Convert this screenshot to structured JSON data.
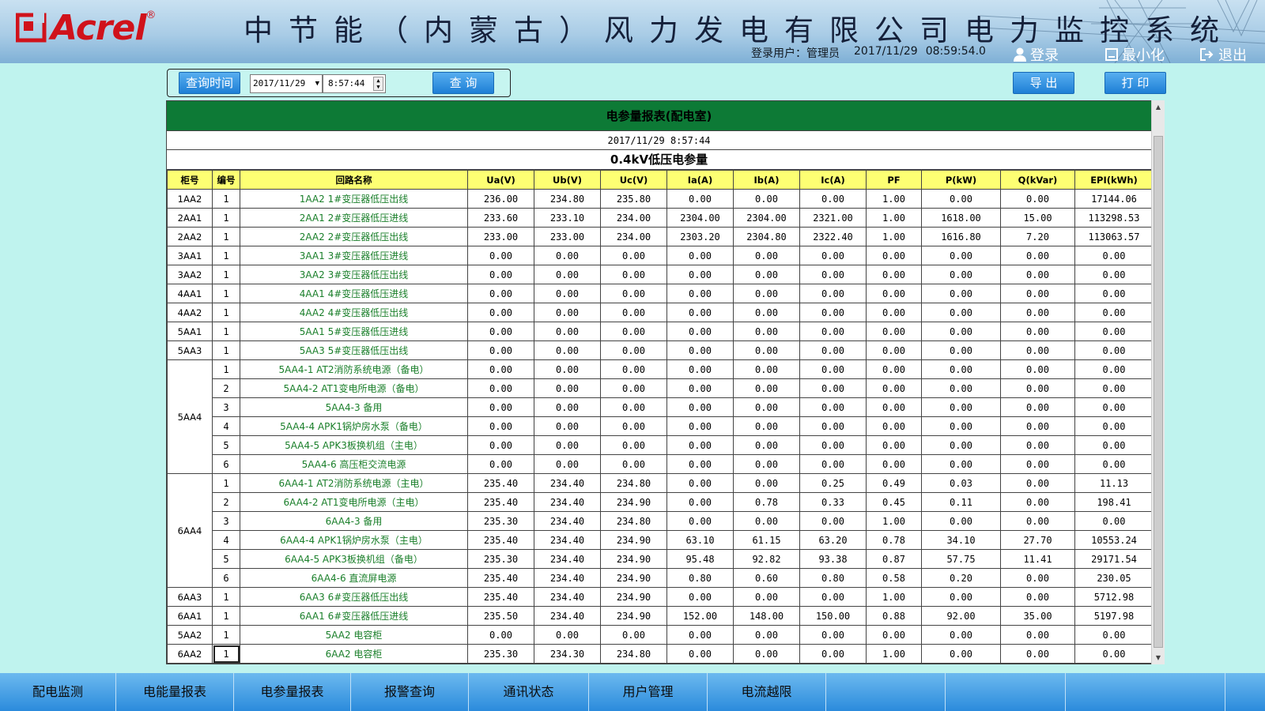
{
  "header": {
    "logo_text": "Acrel",
    "logo_reg": "®",
    "title": "中节能（内蒙古）风力发电有限公司电力监控系统",
    "user_label": "登录用户：",
    "user_name": "管理员",
    "date": "2017/11/29",
    "time": "08:59:54.0",
    "login_label": "登录",
    "minimize_label": "最小化",
    "exit_label": "退出"
  },
  "query": {
    "time_label": "查询时间",
    "date_value": "2017/11/29",
    "time_value": "8:57:44",
    "search_label": "查 询",
    "export_label": "导 出",
    "print_label": "打 印"
  },
  "report": {
    "title": "电参量报表(配电室)",
    "datetime": "2017/11/29 8:57:44",
    "subtitle": "0.4kV低压电参量",
    "columns": [
      "柜号",
      "编号",
      "回路名称",
      "Ua(V)",
      "Ub(V)",
      "Uc(V)",
      "Ia(A)",
      "Ib(A)",
      "Ic(A)",
      "PF",
      "P(kW)",
      "Q(kVar)",
      "EPI(kWh)"
    ],
    "rows": [
      {
        "cab": "1AA2",
        "no": "1",
        "name": "1AA2 1#变压器低压出线",
        "vals": [
          "236.00",
          "234.80",
          "235.80",
          "0.00",
          "0.00",
          "0.00",
          "1.00",
          "0.00",
          "0.00",
          "17144.06"
        ]
      },
      {
        "cab": "2AA1",
        "no": "1",
        "name": "2AA1 2#变压器低压进线",
        "vals": [
          "233.60",
          "233.10",
          "234.00",
          "2304.00",
          "2304.00",
          "2321.00",
          "1.00",
          "1618.00",
          "15.00",
          "113298.53"
        ]
      },
      {
        "cab": "2AA2",
        "no": "1",
        "name": "2AA2 2#变压器低压出线",
        "vals": [
          "233.00",
          "233.00",
          "234.00",
          "2303.20",
          "2304.80",
          "2322.40",
          "1.00",
          "1616.80",
          "7.20",
          "113063.57"
        ]
      },
      {
        "cab": "3AA1",
        "no": "1",
        "name": "3AA1 3#变压器低压进线",
        "vals": [
          "0.00",
          "0.00",
          "0.00",
          "0.00",
          "0.00",
          "0.00",
          "0.00",
          "0.00",
          "0.00",
          "0.00"
        ]
      },
      {
        "cab": "3AA2",
        "no": "1",
        "name": "3AA2 3#变压器低压出线",
        "vals": [
          "0.00",
          "0.00",
          "0.00",
          "0.00",
          "0.00",
          "0.00",
          "0.00",
          "0.00",
          "0.00",
          "0.00"
        ]
      },
      {
        "cab": "4AA1",
        "no": "1",
        "name": "4AA1 4#变压器低压进线",
        "vals": [
          "0.00",
          "0.00",
          "0.00",
          "0.00",
          "0.00",
          "0.00",
          "0.00",
          "0.00",
          "0.00",
          "0.00"
        ]
      },
      {
        "cab": "4AA2",
        "no": "1",
        "name": "4AA2 4#变压器低压出线",
        "vals": [
          "0.00",
          "0.00",
          "0.00",
          "0.00",
          "0.00",
          "0.00",
          "0.00",
          "0.00",
          "0.00",
          "0.00"
        ]
      },
      {
        "cab": "5AA1",
        "no": "1",
        "name": "5AA1 5#变压器低压进线",
        "vals": [
          "0.00",
          "0.00",
          "0.00",
          "0.00",
          "0.00",
          "0.00",
          "0.00",
          "0.00",
          "0.00",
          "0.00"
        ]
      },
      {
        "cab": "5AA3",
        "no": "1",
        "name": "5AA3 5#变压器低压出线",
        "vals": [
          "0.00",
          "0.00",
          "0.00",
          "0.00",
          "0.00",
          "0.00",
          "0.00",
          "0.00",
          "0.00",
          "0.00"
        ]
      },
      {
        "cab": "5AA4",
        "span": 6,
        "no": "1",
        "name": "5AA4-1 AT2消防系统电源（备电）",
        "vals": [
          "0.00",
          "0.00",
          "0.00",
          "0.00",
          "0.00",
          "0.00",
          "0.00",
          "0.00",
          "0.00",
          "0.00"
        ]
      },
      {
        "no": "2",
        "name": "5AA4-2 AT1变电所电源（备电）",
        "vals": [
          "0.00",
          "0.00",
          "0.00",
          "0.00",
          "0.00",
          "0.00",
          "0.00",
          "0.00",
          "0.00",
          "0.00"
        ]
      },
      {
        "no": "3",
        "name": "5AA4-3 备用",
        "vals": [
          "0.00",
          "0.00",
          "0.00",
          "0.00",
          "0.00",
          "0.00",
          "0.00",
          "0.00",
          "0.00",
          "0.00"
        ]
      },
      {
        "no": "4",
        "name": "5AA4-4 APK1锅炉房水泵（备电）",
        "vals": [
          "0.00",
          "0.00",
          "0.00",
          "0.00",
          "0.00",
          "0.00",
          "0.00",
          "0.00",
          "0.00",
          "0.00"
        ]
      },
      {
        "no": "5",
        "name": "5AA4-5 APK3板换机组（主电）",
        "vals": [
          "0.00",
          "0.00",
          "0.00",
          "0.00",
          "0.00",
          "0.00",
          "0.00",
          "0.00",
          "0.00",
          "0.00"
        ]
      },
      {
        "no": "6",
        "name": "5AA4-6 高压柜交流电源",
        "vals": [
          "0.00",
          "0.00",
          "0.00",
          "0.00",
          "0.00",
          "0.00",
          "0.00",
          "0.00",
          "0.00",
          "0.00"
        ]
      },
      {
        "cab": "6AA4",
        "span": 6,
        "no": "1",
        "name": "6AA4-1 AT2消防系统电源（主电）",
        "vals": [
          "235.40",
          "234.40",
          "234.80",
          "0.00",
          "0.00",
          "0.25",
          "0.49",
          "0.03",
          "0.00",
          "11.13"
        ]
      },
      {
        "no": "2",
        "name": "6AA4-2 AT1变电所电源（主电）",
        "vals": [
          "235.40",
          "234.40",
          "234.90",
          "0.00",
          "0.78",
          "0.33",
          "0.45",
          "0.11",
          "0.00",
          "198.41"
        ]
      },
      {
        "no": "3",
        "name": "6AA4-3 备用",
        "vals": [
          "235.30",
          "234.40",
          "234.80",
          "0.00",
          "0.00",
          "0.00",
          "1.00",
          "0.00",
          "0.00",
          "0.00"
        ]
      },
      {
        "no": "4",
        "name": "6AA4-4 APK1锅炉房水泵（主电）",
        "vals": [
          "235.40",
          "234.40",
          "234.90",
          "63.10",
          "61.15",
          "63.20",
          "0.78",
          "34.10",
          "27.70",
          "10553.24"
        ]
      },
      {
        "no": "5",
        "name": "6AA4-5 APK3板换机组（备电）",
        "vals": [
          "235.30",
          "234.40",
          "234.90",
          "95.48",
          "92.82",
          "93.38",
          "0.87",
          "57.75",
          "11.41",
          "29171.54"
        ]
      },
      {
        "no": "6",
        "name": "6AA4-6 直流屏电源",
        "vals": [
          "235.40",
          "234.40",
          "234.90",
          "0.80",
          "0.60",
          "0.80",
          "0.58",
          "0.20",
          "0.00",
          "230.05"
        ]
      },
      {
        "cab": "6AA3",
        "no": "1",
        "name": "6AA3 6#变压器低压出线",
        "vals": [
          "235.40",
          "234.40",
          "234.90",
          "0.00",
          "0.00",
          "0.00",
          "1.00",
          "0.00",
          "0.00",
          "5712.98"
        ]
      },
      {
        "cab": "6AA1",
        "no": "1",
        "name": "6AA1 6#变压器低压进线",
        "vals": [
          "235.50",
          "234.40",
          "234.90",
          "152.00",
          "148.00",
          "150.00",
          "0.88",
          "92.00",
          "35.00",
          "5197.98"
        ]
      },
      {
        "cab": "5AA2",
        "no": "1",
        "name": "5AA2 电容柜",
        "vals": [
          "0.00",
          "0.00",
          "0.00",
          "0.00",
          "0.00",
          "0.00",
          "0.00",
          "0.00",
          "0.00",
          "0.00"
        ]
      },
      {
        "cab": "6AA2",
        "no": "1",
        "name": "6AA2 电容柜",
        "vals": [
          "235.30",
          "234.30",
          "234.80",
          "0.00",
          "0.00",
          "0.00",
          "1.00",
          "0.00",
          "0.00",
          "0.00"
        ],
        "selected": true
      }
    ]
  },
  "nav": {
    "items": [
      "配电监测",
      "电能量报表",
      "电参量报表",
      "报警查询",
      "通讯状态",
      "用户管理",
      "电流越限",
      "",
      "",
      ""
    ]
  },
  "colors": {
    "report_header": "#0d7a36",
    "table_header": "#fdff73",
    "circuit_name": "#1a7f2a",
    "button_blue": "#1e7fd6",
    "background": "#bff3ee"
  }
}
